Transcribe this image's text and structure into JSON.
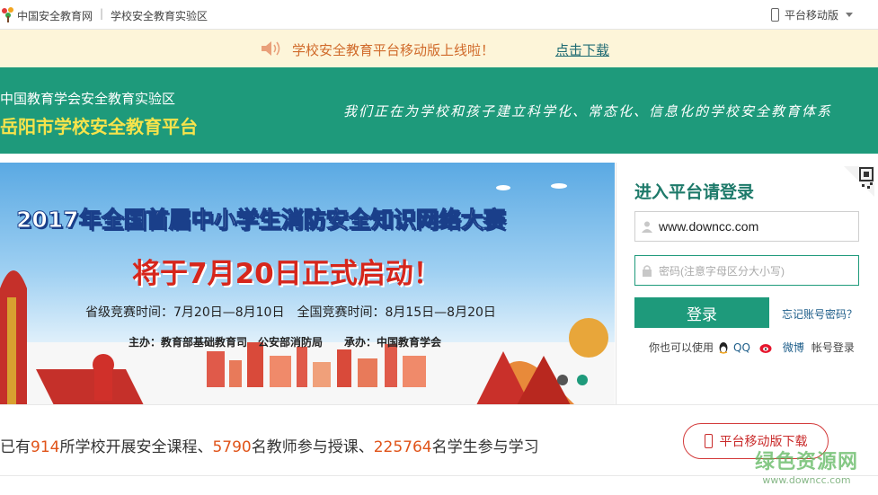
{
  "topbar": {
    "site_name": "中国安全教育网",
    "separator": "|",
    "zone_name": "学校安全教育实验区",
    "mobile_label": "平台移动版"
  },
  "notice": {
    "message": "学校安全教育平台移动版上线啦！",
    "download_link": "点击下载"
  },
  "header": {
    "subtitle": "中国教育学会安全教育实验区",
    "title": "岳阳市学校安全教育平台",
    "slogan": "我们正在为学校和孩子建立科学化、常态化、信息化的学校安全教育体系"
  },
  "banner": {
    "headline": "2017年全国首届中小学生消防安全知识网络大赛",
    "launch": "将于7月20日正式启动！",
    "schedule": "省级竞赛时间：7月20日—8月10日　全国竞赛时间：8月15日—8月20日",
    "organizers": "主办：教育部基础教育司　公安部消防局　　承办：中国教育学会"
  },
  "login": {
    "title": "进入平台请登录",
    "username_value": "www.downcc.com",
    "password_placeholder": "密码(注意字母区分大小写)",
    "login_button": "登录",
    "forget_link": "忘记账号密码？",
    "alt_prefix": "你也可以使用",
    "qq_label": "QQ",
    "weibo_label": "微博",
    "alt_suffix": "帐号登录"
  },
  "stats": {
    "prefix": "已有",
    "schools": "914",
    "schools_suffix": "所学校开展安全课程、",
    "teachers": "5790",
    "teachers_suffix": "名教师参与授课、",
    "students": "225764",
    "students_suffix": "名学生参与学习",
    "mobile_download": "平台移动版下载"
  },
  "watermark": {
    "line1": "绿色资源网",
    "line2": "www.downcc.com"
  },
  "colors": {
    "brand_green": "#1e9a7b",
    "header_title_yellow": "#f6e34b",
    "notice_bg": "#fdf5d9",
    "stat_number_orange": "#e0541a"
  }
}
